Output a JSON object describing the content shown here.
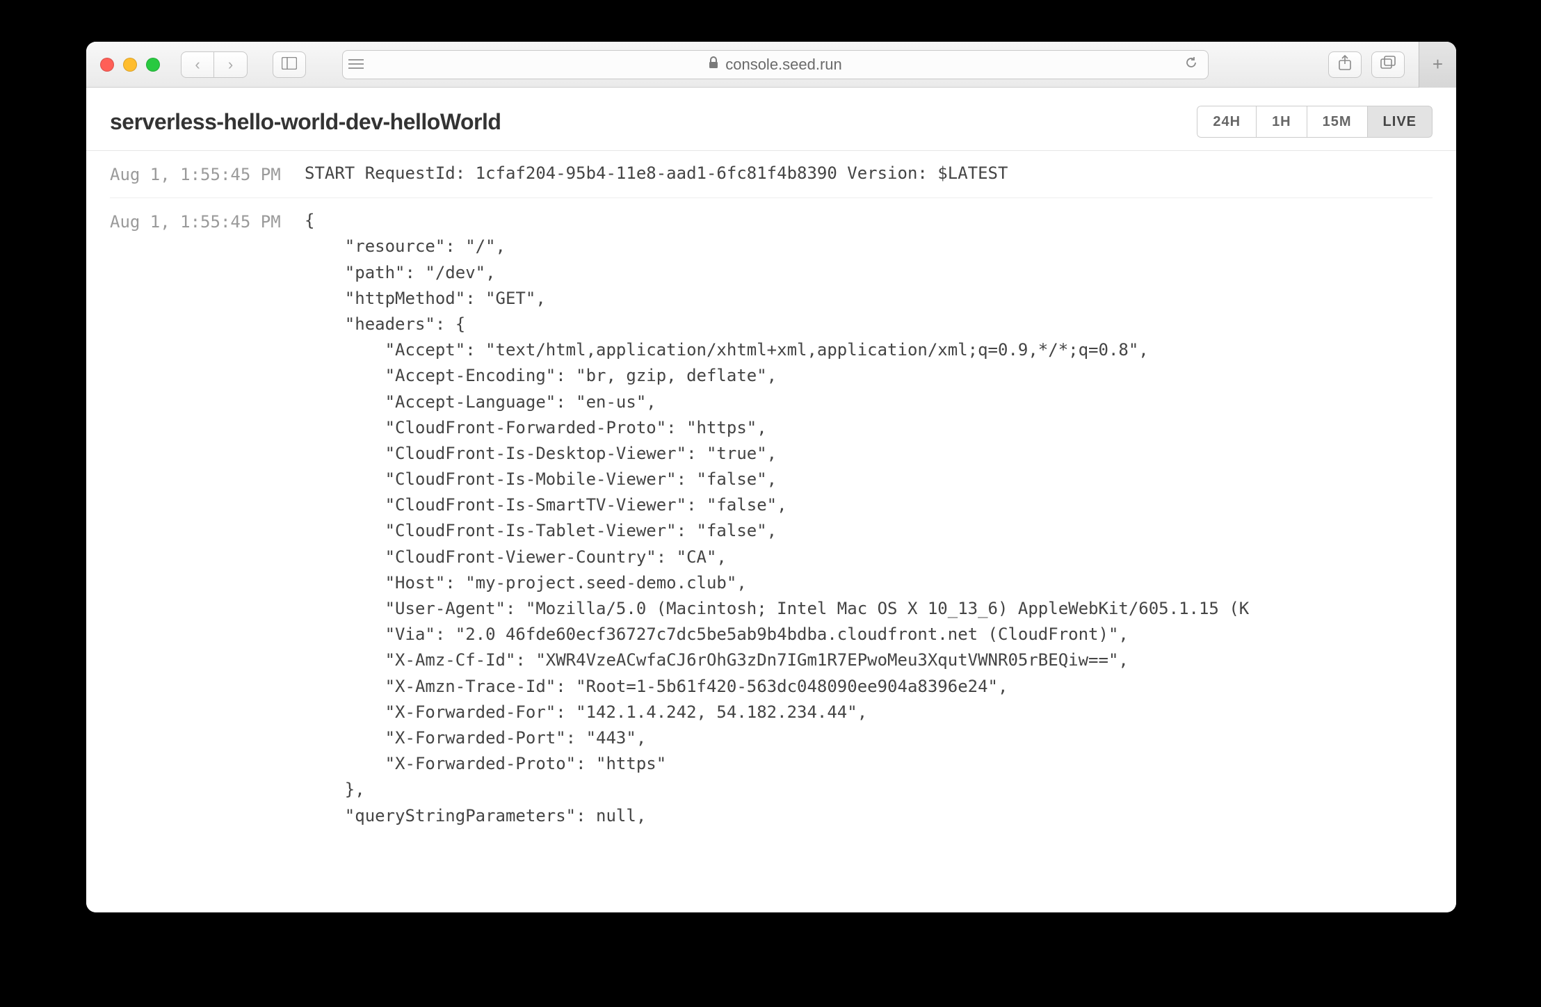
{
  "browser": {
    "url_host": "console.seed.run"
  },
  "page": {
    "title": "serverless-hello-world-dev-helloWorld",
    "filters": {
      "options": [
        "24H",
        "1H",
        "15M",
        "LIVE"
      ],
      "active": "LIVE"
    }
  },
  "logs": [
    {
      "ts": "Aug 1, 1:55:45 PM",
      "text": "START RequestId: 1cfaf204-95b4-11e8-aad1-6fc81f4b8390 Version: $LATEST"
    },
    {
      "ts": "Aug 1, 1:55:45 PM",
      "text": "{\n    \"resource\": \"/\",\n    \"path\": \"/dev\",\n    \"httpMethod\": \"GET\",\n    \"headers\": {\n        \"Accept\": \"text/html,application/xhtml+xml,application/xml;q=0.9,*/*;q=0.8\",\n        \"Accept-Encoding\": \"br, gzip, deflate\",\n        \"Accept-Language\": \"en-us\",\n        \"CloudFront-Forwarded-Proto\": \"https\",\n        \"CloudFront-Is-Desktop-Viewer\": \"true\",\n        \"CloudFront-Is-Mobile-Viewer\": \"false\",\n        \"CloudFront-Is-SmartTV-Viewer\": \"false\",\n        \"CloudFront-Is-Tablet-Viewer\": \"false\",\n        \"CloudFront-Viewer-Country\": \"CA\",\n        \"Host\": \"my-project.seed-demo.club\",\n        \"User-Agent\": \"Mozilla/5.0 (Macintosh; Intel Mac OS X 10_13_6) AppleWebKit/605.1.15 (K\n        \"Via\": \"2.0 46fde60ecf36727c7dc5be5ab9b4bdba.cloudfront.net (CloudFront)\",\n        \"X-Amz-Cf-Id\": \"XWR4VzeACwfaCJ6rOhG3zDn7IGm1R7EPwoMeu3XqutVWNR05rBEQiw==\",\n        \"X-Amzn-Trace-Id\": \"Root=1-5b61f420-563dc048090ee904a8396e24\",\n        \"X-Forwarded-For\": \"142.1.4.242, 54.182.234.44\",\n        \"X-Forwarded-Port\": \"443\",\n        \"X-Forwarded-Proto\": \"https\"\n    },\n    \"queryStringParameters\": null,"
    }
  ]
}
